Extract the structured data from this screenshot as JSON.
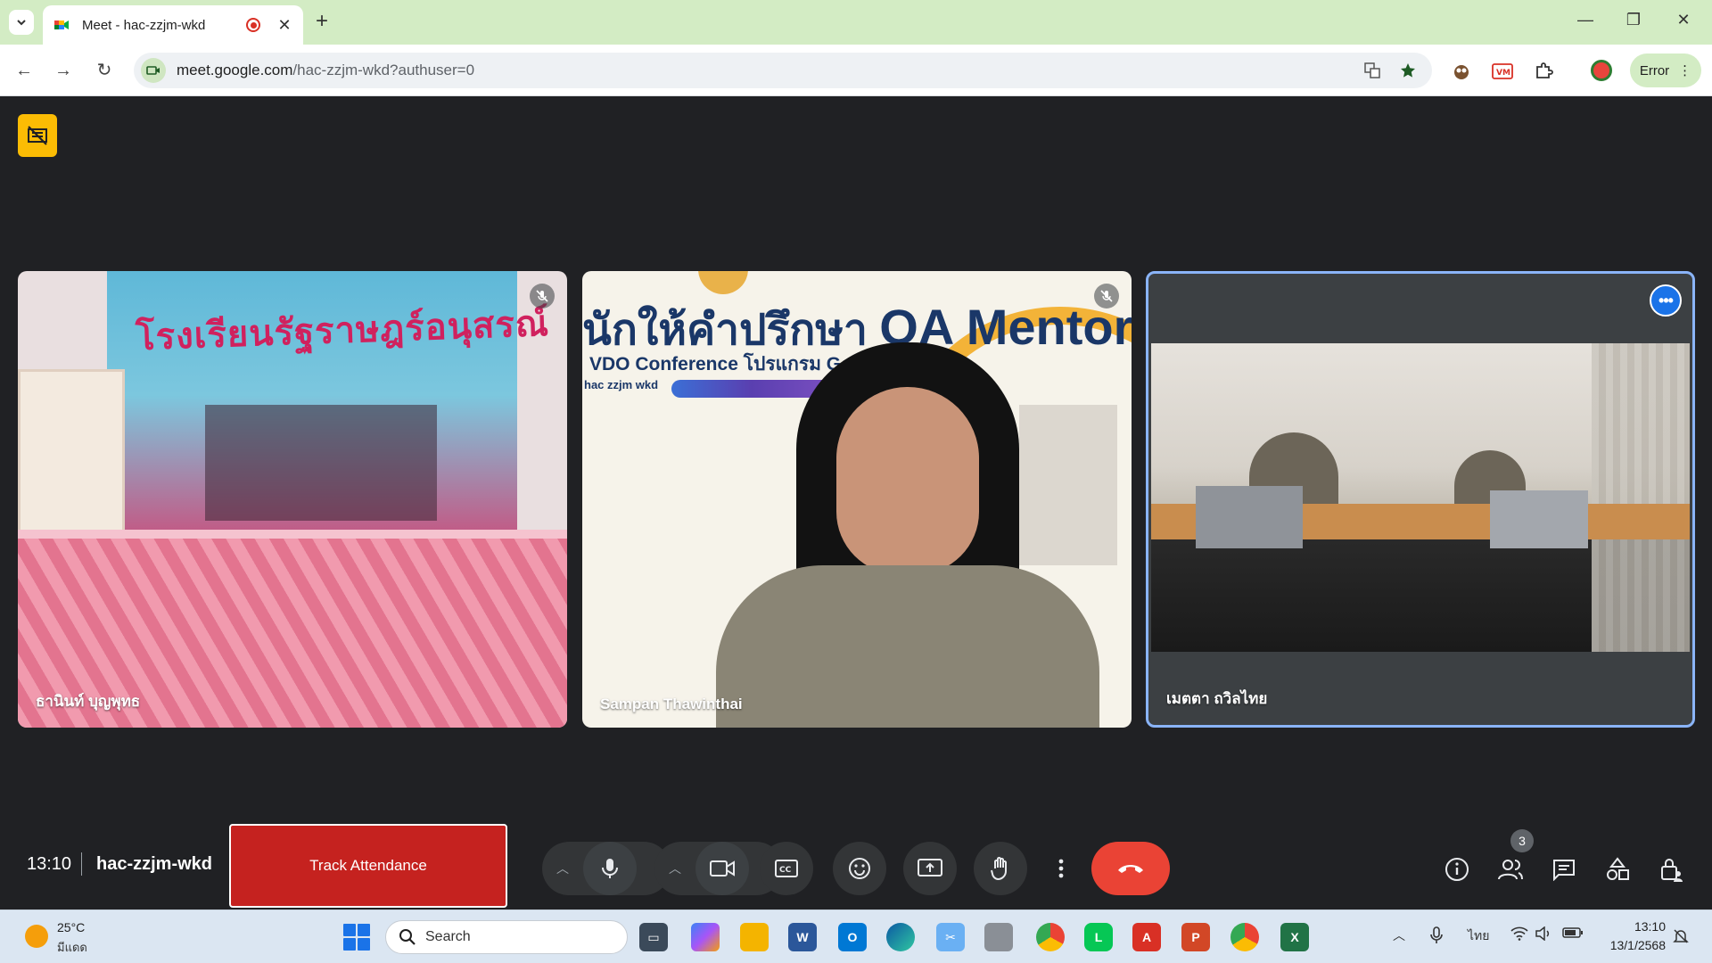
{
  "browser": {
    "tab_title": "Meet - hac-zzjm-wkd",
    "url_host": "meet.google.com",
    "url_path": "/hac-zzjm-wkd?authuser=0",
    "error_label": "Error"
  },
  "meet": {
    "participants": [
      {
        "name": "ธานินท์ บุญพุทธ",
        "muted": true
      },
      {
        "name": "Sampan Thawinthai",
        "muted": true
      },
      {
        "name": "เมตตา ถวิลไทย",
        "muted": false
      }
    ],
    "tile1": {
      "banner_text": "โรงเรียนรัฐราษฎร์อนุสรณ์"
    },
    "tile2": {
      "headline": "นักให้คำปรึกษา",
      "headline_en": "QA Mentor",
      "subtitle": "VDO Conference โปรแกรม Goo",
      "code": "hac zzjm wkd"
    },
    "clock": "13:10",
    "meeting_code": "hac-zzjm-wkd",
    "track_attendance_label": "Track Attendance",
    "people_count": "3"
  },
  "taskbar": {
    "temperature": "25°C",
    "condition": "มีแดด",
    "search_placeholder": "Search",
    "language": "ไทย",
    "time": "13:10",
    "date": "13/1/2568"
  },
  "colors": {
    "meet_bg": "#202124",
    "end_call": "#ea4335",
    "track_attendance": "#c5221f",
    "active_tile_border": "#8ab4f8",
    "tab_strip": "#d3ecc4"
  }
}
